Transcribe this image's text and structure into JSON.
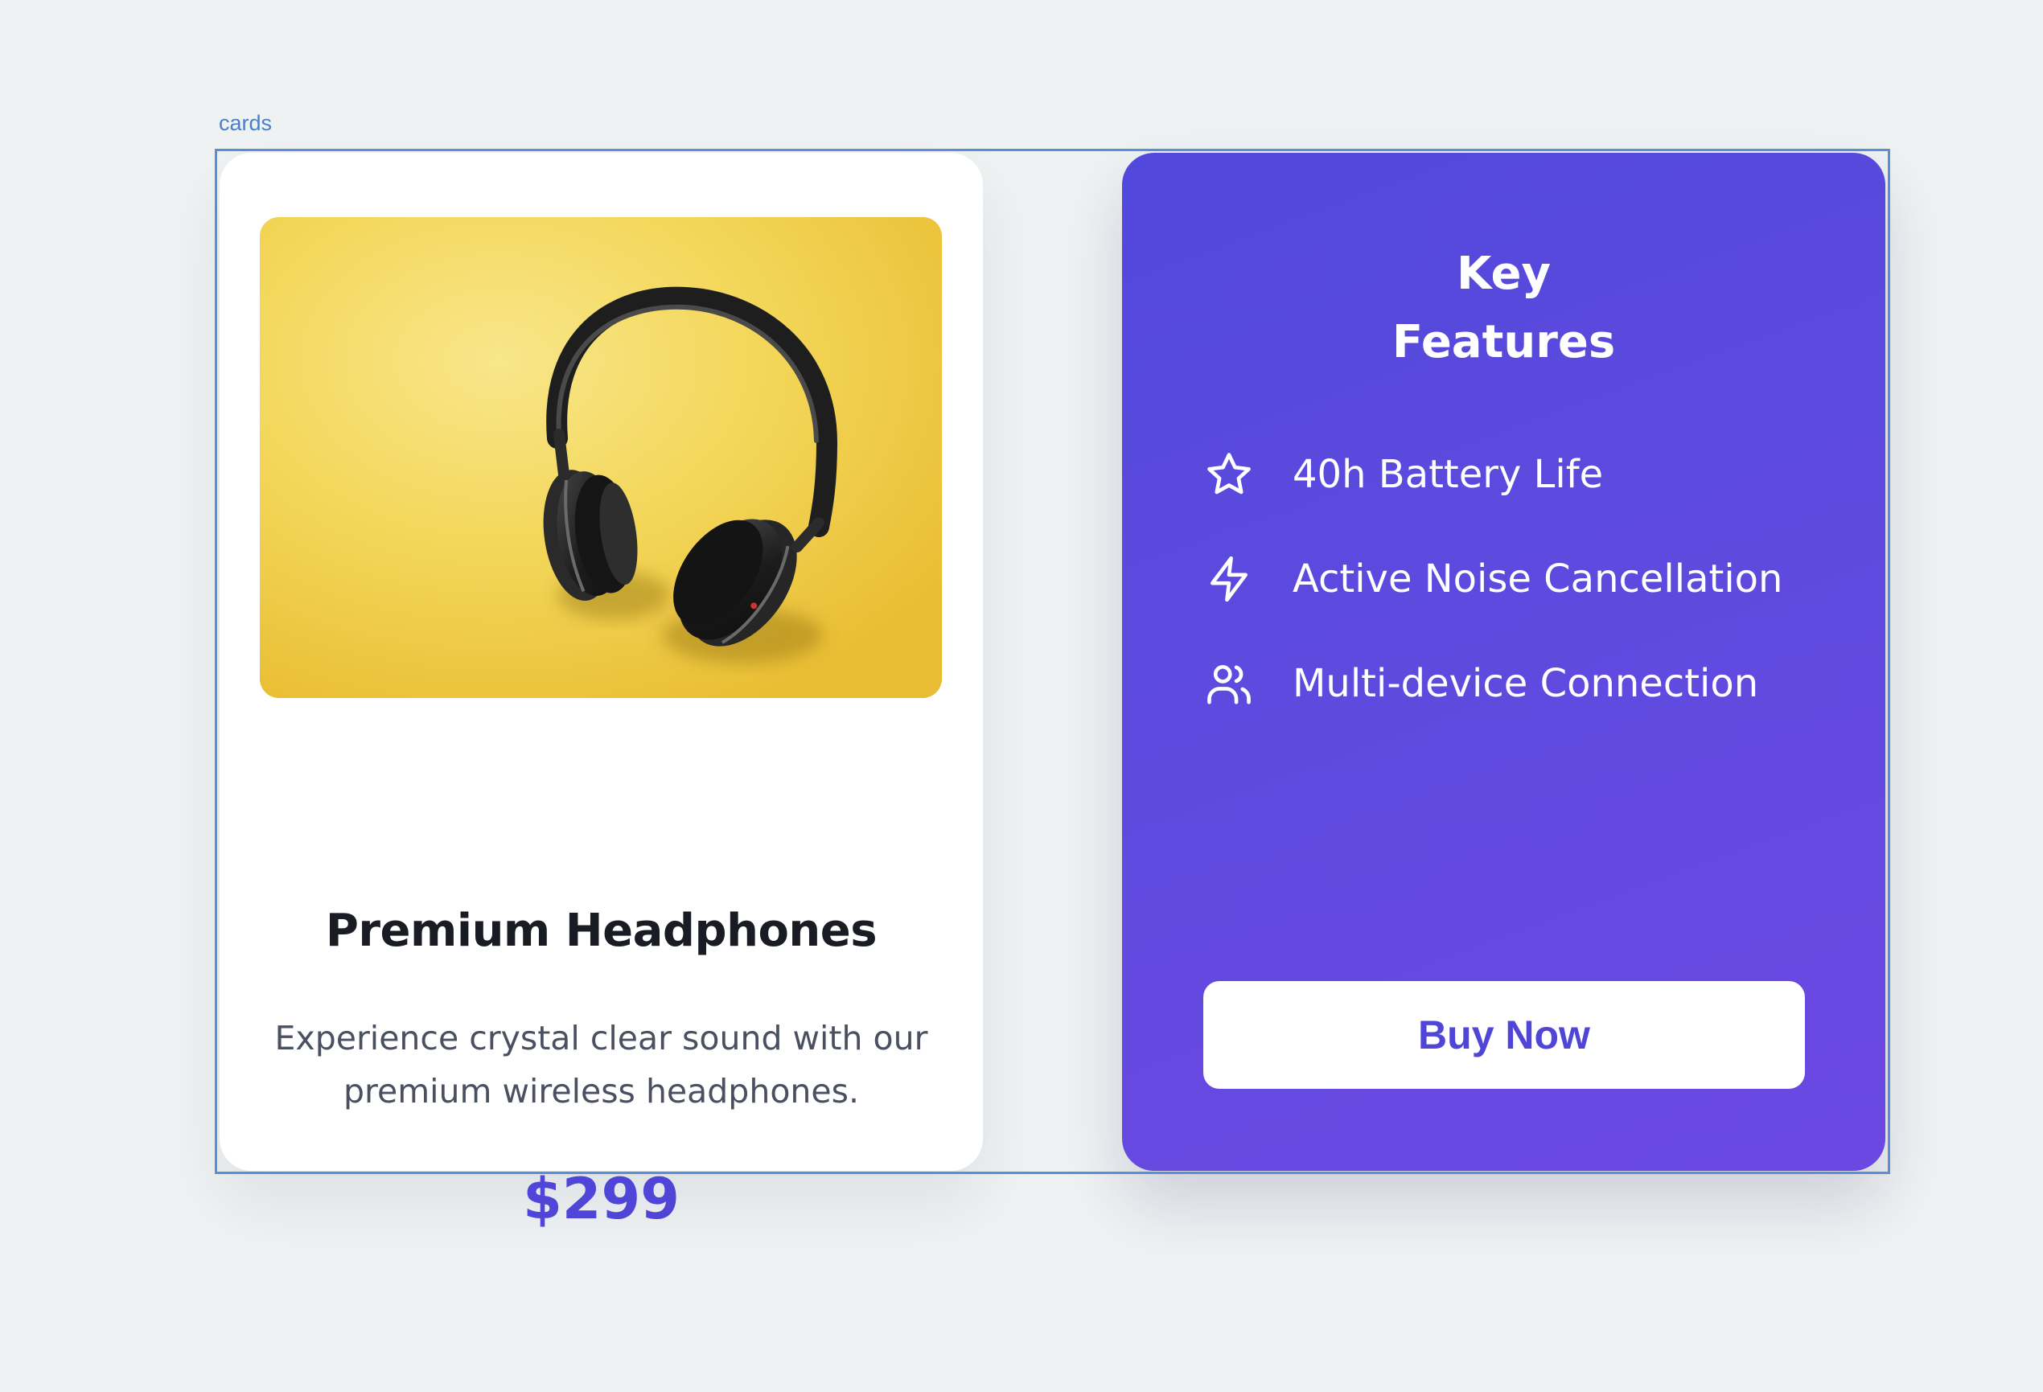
{
  "frame": {
    "label": "cards"
  },
  "product": {
    "image_icon": "headphones-on-yellow-photo",
    "title": "Premium Headphones",
    "description": "Experience crystal clear sound with our premium wireless headphones.",
    "price": "$299"
  },
  "features": {
    "title_line1": "Key",
    "title_line2": "Features",
    "items": [
      {
        "icon": "star-icon",
        "label": "40h Battery Life"
      },
      {
        "icon": "lightning-icon",
        "label": "Active Noise Cancellation"
      },
      {
        "icon": "users-icon",
        "label": "Multi-device Connection"
      }
    ],
    "cta_label": "Buy Now"
  },
  "colors": {
    "background": "#eff2f3",
    "accent": "#4f46d8",
    "gradient_start": "#5248dc",
    "gradient_end": "#6c48e2",
    "frame_outline": "#5a8fd8"
  }
}
